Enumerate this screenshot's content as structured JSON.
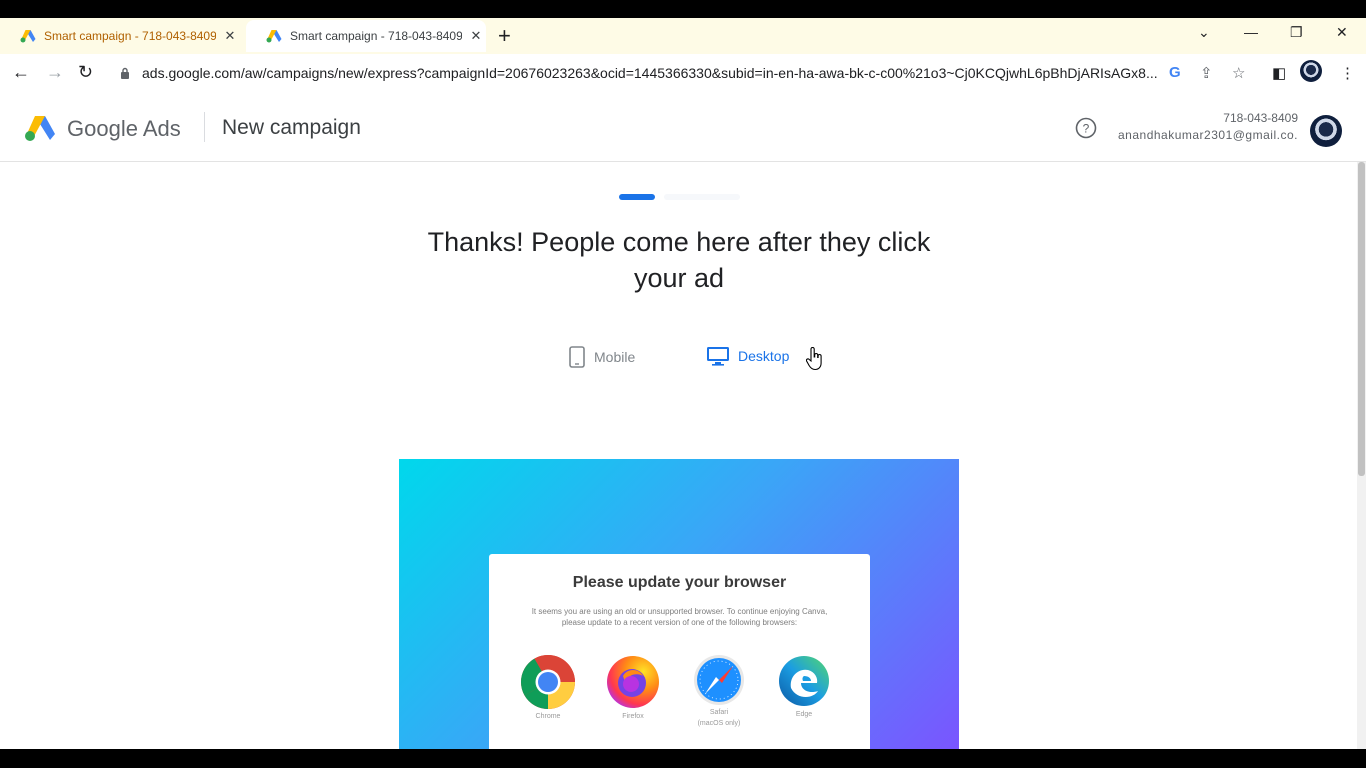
{
  "browser": {
    "tabs": [
      {
        "title": "Smart campaign - 718-043-8409",
        "state": "inactive"
      },
      {
        "title": "Smart campaign - 718-043-8409",
        "state": "active"
      }
    ],
    "new_tab_icon": "plus-icon",
    "url": "ads.google.com/aw/campaigns/new/express?campaignId=20676023263&ocid=1445366330&subid=in-en-ha-awa-bk-c-c00%21o3~Cj0KCQjwhL6pBhDjARIsAGx8..."
  },
  "header": {
    "brand_google": "Google",
    "brand_ads": "Ads",
    "page_title": "New campaign",
    "account_id": "718-043-8409",
    "account_email": "anandhakumar2301@gmail.co..."
  },
  "main": {
    "progress_step": 1,
    "heading_line1": "Thanks! People come here after they click",
    "heading_line2": "your ad",
    "toggle": {
      "mobile_label": "Mobile",
      "desktop_label": "Desktop",
      "selected": "Desktop"
    }
  },
  "preview": {
    "card_title": "Please update your browser",
    "card_text_line1": "It seems you are using an old or unsupported browser. To continue enjoying Canva,",
    "card_text_line2": "please update to a recent version of one of the following browsers:",
    "browsers": [
      {
        "name": "Chrome",
        "note": ""
      },
      {
        "name": "Firefox",
        "note": ""
      },
      {
        "name": "Safari",
        "note": "(macOS only)"
      },
      {
        "name": "Edge",
        "note": ""
      }
    ]
  },
  "colors": {
    "accent": "#1a73e8",
    "tabstrip": "#fefbe6",
    "preview_gradient_start": "#00d8ec",
    "preview_gradient_end": "#7a55ff"
  }
}
